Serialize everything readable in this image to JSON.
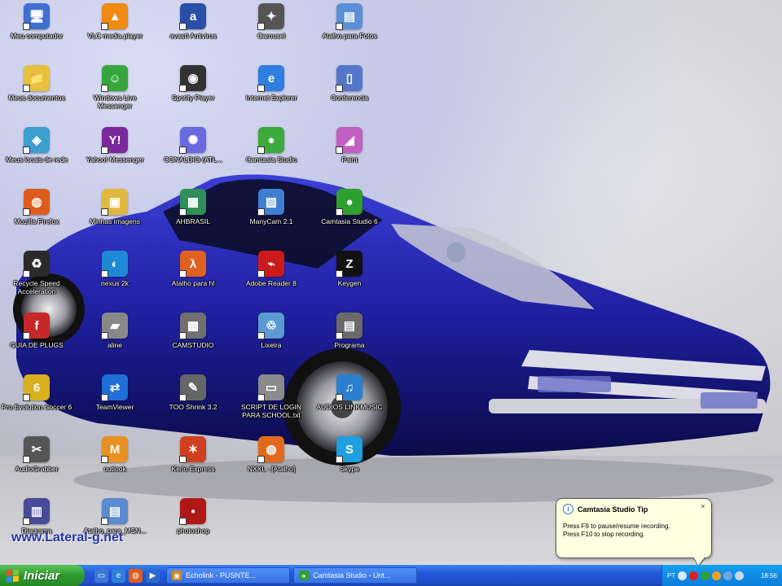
{
  "desktop": {
    "icons": [
      {
        "label": "Meu computador",
        "glyph": "🖥",
        "color": "#3f6fcf"
      },
      {
        "label": "VLC media player",
        "glyph": "▲",
        "color": "#f08a10"
      },
      {
        "label": "avast! Antivirus",
        "glyph": "a",
        "color": "#2a4fa8"
      },
      {
        "label": "Carousel",
        "glyph": "✦",
        "color": "#555555"
      },
      {
        "label": "Atalho para Fotos",
        "glyph": "▤",
        "color": "#5b8fd8"
      },
      {
        "label": "Meus documentos",
        "glyph": "📁",
        "color": "#e8c040"
      },
      {
        "label": "Windows Live Messenger",
        "glyph": "☺",
        "color": "#36a63c"
      },
      {
        "label": "Spotify Player",
        "glyph": "◉",
        "color": "#333333"
      },
      {
        "label": "Internet Explorer",
        "glyph": "e",
        "color": "#2f7fe0"
      },
      {
        "label": "Conferencia",
        "glyph": "▯",
        "color": "#5576c9"
      },
      {
        "label": "Meus locais de rede",
        "glyph": "◈",
        "color": "#3d9ed0"
      },
      {
        "label": "Yahoo! Messenger",
        "glyph": "Y!",
        "color": "#7a2a9c"
      },
      {
        "label": "CONALDIO (ATL...",
        "glyph": "✺",
        "color": "#6a6ae0"
      },
      {
        "label": "Camtasia Studio",
        "glyph": "●",
        "color": "#3caa3c"
      },
      {
        "label": "Paint",
        "glyph": "◢",
        "color": "#c060c0"
      },
      {
        "label": "Mozilla Firefox",
        "glyph": "◍",
        "color": "#e05c1c"
      },
      {
        "label": "Minhas imagens",
        "glyph": "▣",
        "color": "#e0b840"
      },
      {
        "label": "AHBRASIL",
        "glyph": "▦",
        "color": "#2f8f5a"
      },
      {
        "label": "ManyCam 2.1",
        "glyph": "▧",
        "color": "#3f7fd0"
      },
      {
        "label": "Camtasia Studio 6",
        "glyph": "●",
        "color": "#2ea02e"
      },
      {
        "label": "Recycle Speed Acceleration",
        "glyph": "♻",
        "color": "#2a2a2a"
      },
      {
        "label": "nexus 2k",
        "glyph": "◐",
        "color": "#1e8ad6"
      },
      {
        "label": "Atalho para hl",
        "glyph": "λ",
        "color": "#e06020"
      },
      {
        "label": "Adobe Reader 8",
        "glyph": "⌁",
        "color": "#cc1a1a"
      },
      {
        "label": "Keygen",
        "glyph": "Z",
        "color": "#111111"
      },
      {
        "label": "GUIA DE PLUGS",
        "glyph": "f",
        "color": "#c62828"
      },
      {
        "label": "aline",
        "glyph": "▰",
        "color": "#888888"
      },
      {
        "label": "CAMSTUDIO",
        "glyph": "▩",
        "color": "#707070"
      },
      {
        "label": "Lixeira",
        "glyph": "♲",
        "color": "#5a9ad0"
      },
      {
        "label": "Programa",
        "glyph": "▤",
        "color": "#6a6a6a"
      },
      {
        "label": "Pro Evolution Soccer 6",
        "glyph": "6",
        "color": "#d8b020"
      },
      {
        "label": "TeamViewer",
        "glyph": "⇄",
        "color": "#1f6fd6"
      },
      {
        "label": "TOO Shrink 3.2",
        "glyph": "✎",
        "color": "#666666"
      },
      {
        "label": "SCRIPT DE LOGIN PARA SCHOOL.txt",
        "glyph": "▭",
        "color": "#8a8a8a"
      },
      {
        "label": "AUDIOS LINKMUSIC",
        "glyph": "♫",
        "color": "#2a7fcf"
      },
      {
        "label": "AudioGrabber",
        "glyph": "✂",
        "color": "#555555"
      },
      {
        "label": "outlook",
        "glyph": "M",
        "color": "#e89020"
      },
      {
        "label": "Kerio Express",
        "glyph": "✶",
        "color": "#d04020"
      },
      {
        "label": "NXXL - [Atalho]",
        "glyph": "◍",
        "color": "#e06a1c"
      },
      {
        "label": "Skype",
        "glyph": "S",
        "color": "#1ea0e0"
      },
      {
        "label": "Diagrama",
        "glyph": "▥",
        "color": "#4a4a9a"
      },
      {
        "label": "Atalho_para_MSN...",
        "glyph": "▤",
        "color": "#5a8ad0"
      },
      {
        "label": "photoshop",
        "glyph": "▪",
        "color": "#b01818"
      }
    ]
  },
  "watermark": "www.Lateral-g.net",
  "tip": {
    "title": "Camtasia Studio Tip",
    "line1": "Press F9 to pause/resume recording.",
    "line2": "Press F10 to stop recording.",
    "close": "×",
    "info": "i"
  },
  "taskbar": {
    "start_label": "Iniciar",
    "quick_launch": [
      {
        "name": "show-desktop-icon",
        "glyph": "▭",
        "color": "#3b78d8"
      },
      {
        "name": "ie-quick-icon",
        "glyph": "e",
        "color": "#2f7fe0"
      },
      {
        "name": "firefox-quick-icon",
        "glyph": "◍",
        "color": "#e05c1c"
      },
      {
        "name": "media-quick-icon",
        "glyph": "▶",
        "color": "#2a6acc"
      }
    ],
    "tasks": [
      {
        "label": "Echolink - PUSNTE...",
        "glyph": "▣",
        "color": "#cc8a20"
      },
      {
        "label": "Camtasia Studio - Unt...",
        "glyph": "●",
        "color": "#2ea02e"
      }
    ],
    "tray": {
      "language": "PT",
      "clock": "18:56"
    }
  }
}
